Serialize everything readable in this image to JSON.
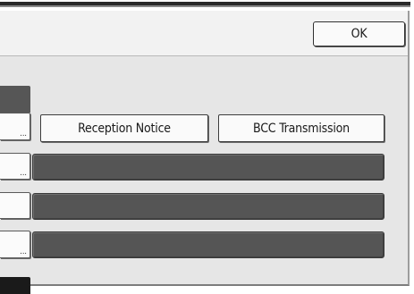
{
  "header": {
    "ok_label": "OK"
  },
  "options": {
    "reception_notice_label": "Reception Notice",
    "bcc_transmission_label": "BCC Transmission"
  },
  "entry_rows": [
    {
      "more_label": "..."
    },
    {
      "more_label": "..."
    },
    {
      "more_label": ""
    },
    {
      "more_label": "..."
    }
  ]
}
